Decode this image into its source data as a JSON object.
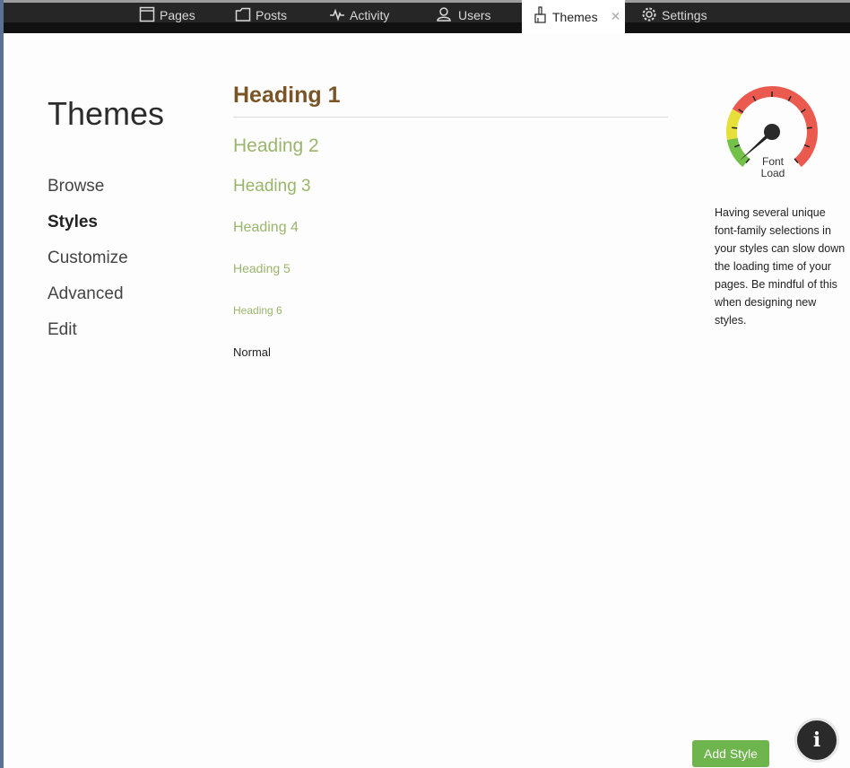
{
  "tabs": [
    {
      "label": "Pages",
      "icon": "pages-icon"
    },
    {
      "label": "Posts",
      "icon": "posts-icon"
    },
    {
      "label": "Activity",
      "icon": "activity-icon"
    },
    {
      "label": "Users",
      "icon": "users-icon"
    },
    {
      "label": "Themes",
      "icon": "brush-icon",
      "active": true,
      "close": "✕"
    },
    {
      "label": "Settings",
      "icon": "gear-icon"
    }
  ],
  "page": {
    "title": "Themes"
  },
  "nav": {
    "items": [
      "Browse",
      "Styles",
      "Customize",
      "Advanced",
      "Edit"
    ],
    "active": "Styles"
  },
  "preview": {
    "h1": "Heading 1",
    "h2": "Heading 2",
    "h3": "Heading 3",
    "h4": "Heading 4",
    "h5": "Heading 5",
    "h6": "Heading 6",
    "normal": "Normal"
  },
  "gauge": {
    "label_line1": "Font",
    "label_line2": "Load",
    "level": 0.03,
    "colors": {
      "green": "#74c14a",
      "yellow": "#e8e03a",
      "red": "#eb5a4f"
    }
  },
  "note": "Having several unique font-family selections in your styles can slow down the loading time of your pages. Be mindful of this when designing new styles.",
  "buttons": {
    "add_style": "Add Style",
    "info": "i"
  },
  "colors": {
    "heading1": "#7a5426",
    "heading_green": "#9ab56c",
    "accent_button": "#6fb54d"
  }
}
